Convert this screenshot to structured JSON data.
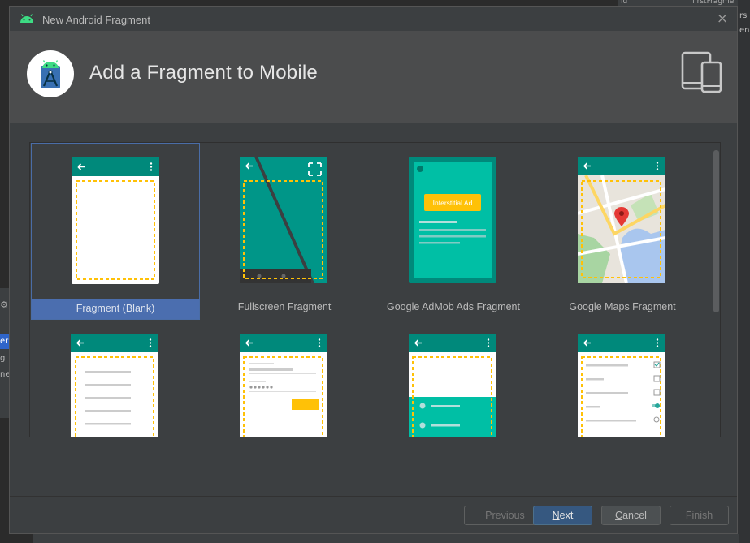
{
  "dialog": {
    "window_title": "New Android Fragment",
    "close_glyph": "×",
    "heading": "Add a Fragment to Mobile"
  },
  "templates": [
    {
      "label": "Fragment (Blank)",
      "selected": true,
      "icon": "blank-fragment-preview"
    },
    {
      "label": "Fullscreen Fragment",
      "selected": false,
      "icon": "fullscreen-fragment-preview"
    },
    {
      "label": "Google AdMob Ads Fragment",
      "selected": false,
      "icon": "admob-fragment-preview",
      "ad_text": "Interstitial Ad"
    },
    {
      "label": "Google Maps Fragment",
      "selected": false,
      "icon": "maps-fragment-preview"
    },
    {
      "label": "",
      "selected": false,
      "icon": "list-fragment-preview"
    },
    {
      "label": "",
      "selected": false,
      "icon": "login-fragment-preview"
    },
    {
      "label": "",
      "selected": false,
      "icon": "modal-bottom-sheet-preview"
    },
    {
      "label": "",
      "selected": false,
      "icon": "settings-fragment-preview"
    }
  ],
  "buttons": {
    "previous": "Previous",
    "next_mnemonic": "N",
    "next_rest": "ext",
    "cancel_mnemonic": "C",
    "cancel_rest": "ancel",
    "finish": "Finish"
  },
  "background": {
    "right_cells": [
      "ld",
      "rs",
      "en"
    ],
    "top_text": "ld",
    "top_text_2": "firstFragme",
    "left_cells": [
      "er",
      "g",
      "ne"
    ]
  },
  "colors": {
    "teal_dark": "#00897b",
    "teal": "#26a69a",
    "teal_light": "#00bfa5",
    "dash_yellow": "#ffc107",
    "selection": "#4b6eaf"
  }
}
